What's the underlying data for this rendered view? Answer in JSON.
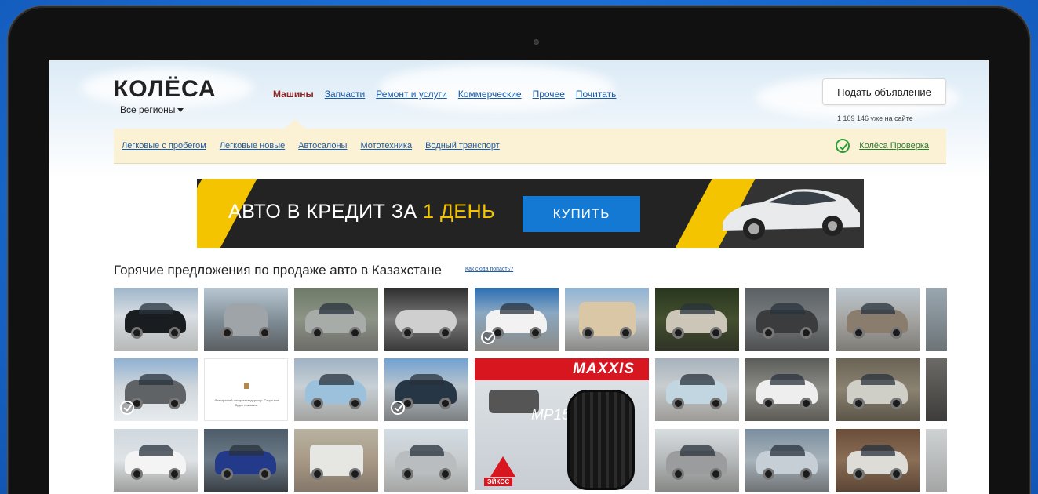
{
  "header": {
    "logo": "КОЛЁСА",
    "region": "Все регионы",
    "post_button": "Подать объявление",
    "online_count": "1 109 146 уже на сайте"
  },
  "main_nav": {
    "items": [
      "Машины",
      "Запчасти",
      "Ремонт и услуги",
      "Коммерческие",
      "Прочее",
      "Почитать"
    ],
    "active": "Машины"
  },
  "sub_nav": {
    "items": [
      "Легковые с пробегом",
      "Легковые новые",
      "Автосалоны",
      "Мототехника",
      "Водный транспорт"
    ],
    "verify_label": "Колёса Проверка"
  },
  "banner": {
    "text_main": "АВТО В КРЕДИТ ЗА",
    "text_accent": "1 ДЕНЬ",
    "button": "КУПИТЬ"
  },
  "hot_offers": {
    "title": "Горячие предложения по продаже авто в Казахстане",
    "how_link": "Как сюда попасть?",
    "placeholder_text": "Фотографий ожидает модератор. Скоро все будет показано."
  },
  "ad": {
    "brand": "MAXXIS",
    "model": "MP15",
    "dealer": "ЭЙКОС"
  },
  "colors": {
    "link": "#1a5aa6",
    "active_nav": "#8e2424",
    "subnav_bg": "#fbf1d4",
    "banner_accent": "#f5c400",
    "buy_button": "#1479d3",
    "verify_green": "#2a9d3a"
  }
}
